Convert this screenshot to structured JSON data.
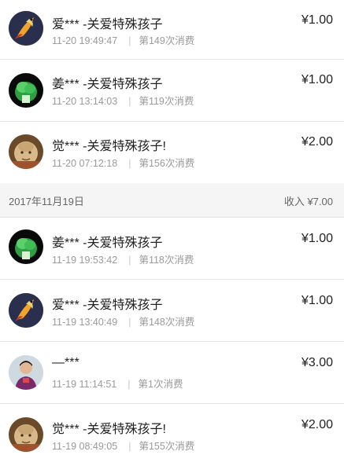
{
  "records_top": [
    {
      "avatar": "koi-fish-avatar",
      "name": "爱*** -关爱特殊孩子",
      "amount": "¥1.00",
      "time": "11-20 19:49:47",
      "count": "第149次消费"
    },
    {
      "avatar": "jade-cabbage-avatar",
      "name": "姜*** -关爱特殊孩子",
      "amount": "¥1.00",
      "time": "11-20 13:14:03",
      "count": "第119次消费"
    },
    {
      "avatar": "buddha-avatar",
      "name": "觉*** -关爱特殊孩子!",
      "amount": "¥2.00",
      "time": "11-20 07:12:18",
      "count": "第156次消费"
    }
  ],
  "section": {
    "date": "2017年11月19日",
    "income": "收入 ¥7.00"
  },
  "records_bottom": [
    {
      "avatar": "jade-cabbage-avatar",
      "name": "姜*** -关爱特殊孩子",
      "amount": "¥1.00",
      "time": "11-19 19:53:42",
      "count": "第118次消费"
    },
    {
      "avatar": "koi-fish-avatar",
      "name": "爱*** -关爱特殊孩子",
      "amount": "¥1.00",
      "time": "11-19 13:40:49",
      "count": "第148次消费"
    },
    {
      "avatar": "person-photo-avatar",
      "name": "—***",
      "amount": "¥3.00",
      "time": "11-19 11:14:51",
      "count": "第1次消费"
    },
    {
      "avatar": "buddha-avatar",
      "name": "觉*** -关爱特殊孩子!",
      "amount": "¥2.00",
      "time": "11-19 08:49:05",
      "count": "第155次消费"
    }
  ]
}
